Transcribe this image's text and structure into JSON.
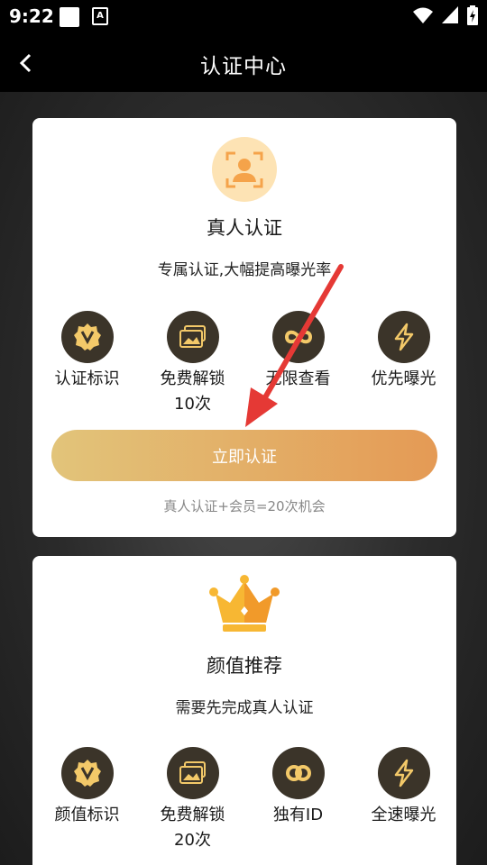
{
  "status_bar": {
    "time": "9:22",
    "notif2": "A"
  },
  "header": {
    "title": "认证中心"
  },
  "real_person_card": {
    "title": "真人认证",
    "subtitle": "专属认证,大幅提高曝光率",
    "perks": [
      {
        "label": "认证标识",
        "icon": "v-badge-icon"
      },
      {
        "label": "免费解锁",
        "sub": "10次",
        "icon": "photos-icon"
      },
      {
        "label": "无限查看",
        "icon": "infinity-icon"
      },
      {
        "label": "优先曝光",
        "icon": "lightning-icon"
      }
    ],
    "button": "立即认证",
    "note": "真人认证+会员=20次机会"
  },
  "beauty_card": {
    "title": "颜值推荐",
    "subtitle": "需要先完成真人认证",
    "perks": [
      {
        "label": "颜值标识",
        "icon": "v-badge-icon"
      },
      {
        "label": "免费解锁",
        "sub": "20次",
        "icon": "photos-icon"
      },
      {
        "label": "独有ID",
        "icon": "id-rings-icon"
      },
      {
        "label": "全速曝光",
        "icon": "lightning-icon"
      }
    ]
  },
  "colors": {
    "accent_start": "#e2c47a",
    "accent_end": "#e49a55",
    "arrow": "#e53935",
    "perk_icon_bg": "#3b3429"
  }
}
